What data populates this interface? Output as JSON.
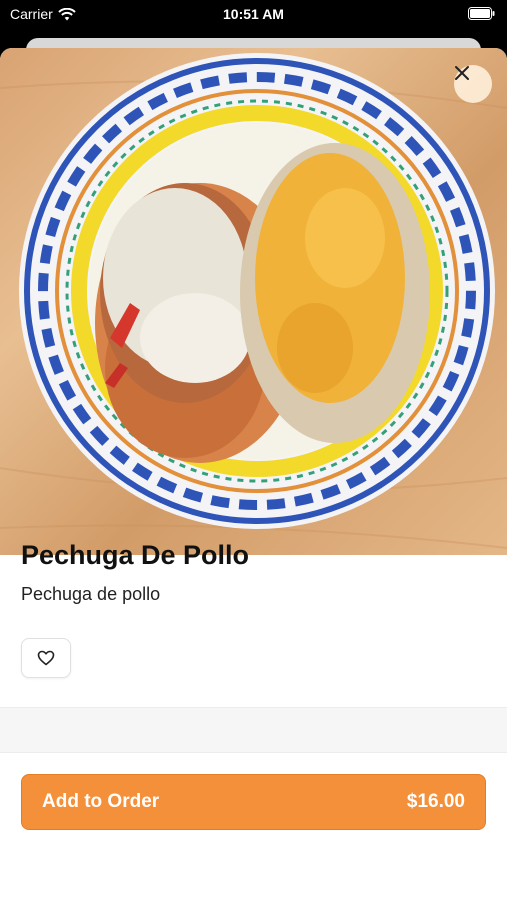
{
  "status_bar": {
    "carrier": "Carrier",
    "time": "10:51 AM"
  },
  "item": {
    "name": "Pechuga De Pollo",
    "description": "Pechuga de pollo",
    "price": "$16.00"
  },
  "actions": {
    "add_label": "Add to Order"
  },
  "icons": {
    "close": "close-icon",
    "favorite": "heart-icon",
    "wifi": "wifi-icon",
    "battery": "battery-icon"
  },
  "colors": {
    "accent": "#f5903a",
    "accent_border": "#e27d25"
  }
}
